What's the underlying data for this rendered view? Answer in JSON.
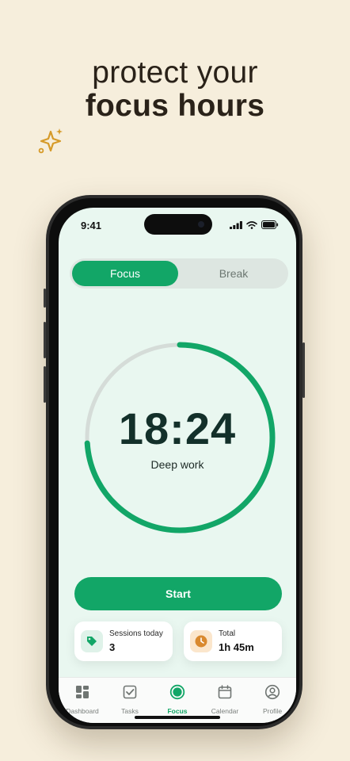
{
  "headline": {
    "line1": "protect your",
    "line2": "focus hours"
  },
  "status_bar": {
    "time": "9:41"
  },
  "mode_toggle": {
    "focus_label": "Focus",
    "break_label": "Break",
    "selected": "Focus"
  },
  "timer": {
    "time": "18:24",
    "label": "Deep work",
    "progress": 0.74
  },
  "start_button": {
    "label": "Start"
  },
  "stats": {
    "sessions": {
      "label": "Sessions today",
      "value": "3"
    },
    "total": {
      "label": "Total",
      "value": "1h 45m"
    }
  },
  "tabs": [
    {
      "label": "Dashboard",
      "icon": "dashboard-icon"
    },
    {
      "label": "Tasks",
      "icon": "tasks-icon"
    },
    {
      "label": "Focus",
      "icon": "focus-icon",
      "active": true
    },
    {
      "label": "Calendar",
      "icon": "calendar-icon"
    },
    {
      "label": "Profile",
      "icon": "profile-icon"
    }
  ],
  "colors": {
    "accent": "#12a667",
    "background": "#f6eedc",
    "screen": "#e9f7f0",
    "accent_orange": "#d9892f"
  }
}
